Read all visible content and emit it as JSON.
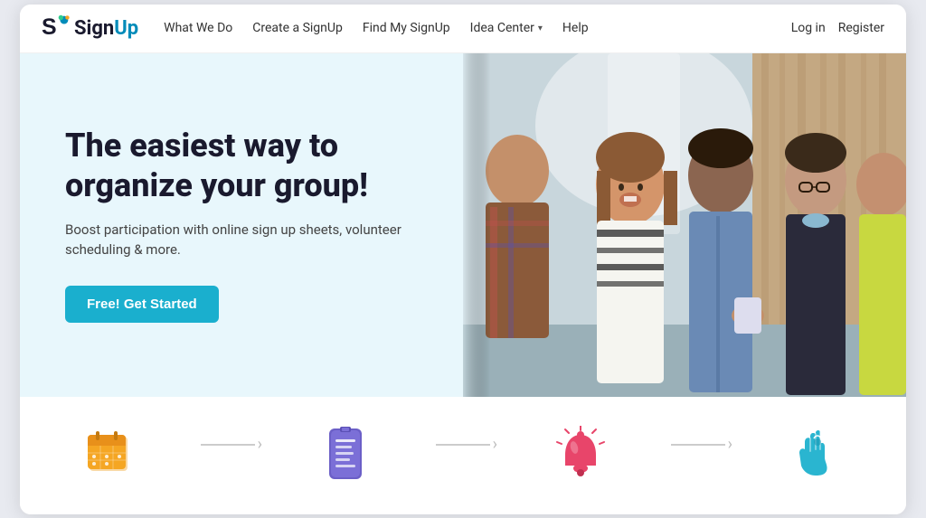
{
  "page": {
    "bg_color": "#e8eaf0"
  },
  "navbar": {
    "logo_text": "SignUp",
    "logo_sign": "Sign",
    "logo_up": "Up",
    "nav_items": [
      {
        "label": "What We Do",
        "has_dropdown": false
      },
      {
        "label": "Create a SignUp",
        "has_dropdown": false
      },
      {
        "label": "Find My SignUp",
        "has_dropdown": false
      },
      {
        "label": "Idea Center",
        "has_dropdown": true
      },
      {
        "label": "Help",
        "has_dropdown": false
      }
    ],
    "auth": {
      "login": "Log in",
      "register": "Register"
    }
  },
  "hero": {
    "title": "The easiest way to organize your group!",
    "subtitle": "Boost participation with online sign up sheets, volunteer scheduling & more.",
    "cta_label": "Free! Get Started"
  },
  "steps": [
    {
      "id": 1,
      "icon_type": "calendar",
      "color": "#f5a623"
    },
    {
      "id": 2,
      "icon_type": "list",
      "color": "#7b68ee"
    },
    {
      "id": 3,
      "icon_type": "bell",
      "color": "#e8456a"
    },
    {
      "id": 4,
      "icon_type": "hand",
      "color": "#008bb9"
    }
  ]
}
